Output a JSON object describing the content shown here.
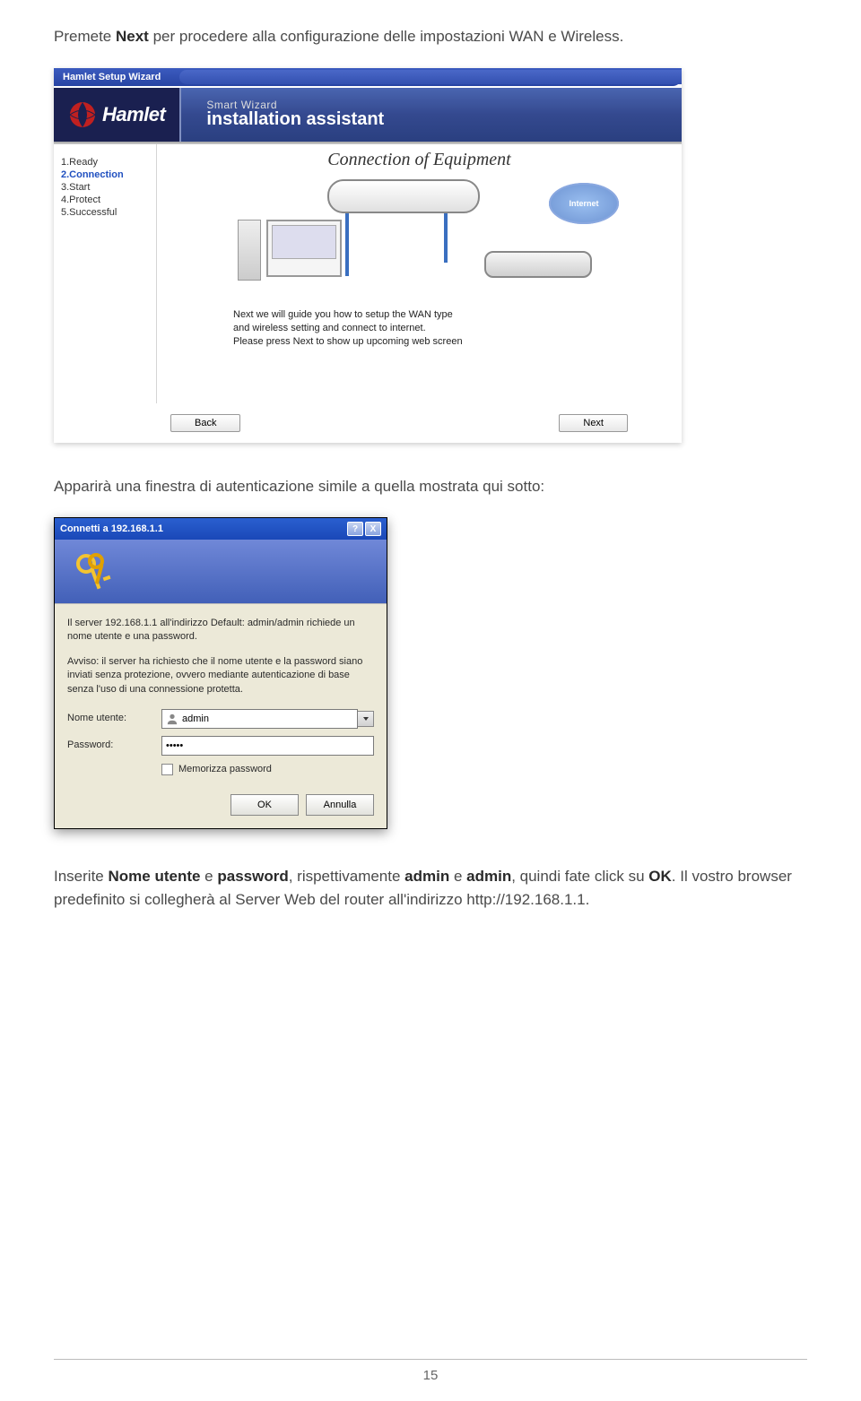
{
  "intro": {
    "pre": "Premete ",
    "bold": "Next",
    "post": " per procedere alla configurazione delle impostazioni WAN e Wireless."
  },
  "wizard": {
    "window_title": "Hamlet Setup Wizard",
    "logo_text": "Hamlet",
    "header_small": "Smart Wizard",
    "header_big": "installation assistant",
    "main_title": "Connection of Equipment",
    "sidebar": [
      {
        "label": "1.Ready"
      },
      {
        "label": "2.Connection",
        "active": true
      },
      {
        "label": "3.Start"
      },
      {
        "label": "4.Protect"
      },
      {
        "label": "5.Successful"
      }
    ],
    "cloud_label": "Internet",
    "instruction_l1": "Next we will guide you how to setup the WAN type",
    "instruction_l2": "and wireless setting and connect to internet.",
    "instruction_l3": "Please press Next to show up upcoming web screen",
    "back_btn": "Back",
    "next_btn": "Next"
  },
  "mid_para": "Apparirà una finestra di autenticazione simile a quella mostrata qui sotto:",
  "auth": {
    "title": "Connetti a 192.168.1.1",
    "help_btn": "?",
    "close_btn": "X",
    "line1": "Il server 192.168.1.1 all'indirizzo Default: admin/admin richiede un nome utente e una password.",
    "warn": "Avviso: il server ha richiesto che il nome utente e la password siano inviati senza protezione, ovvero mediante autenticazione di base senza l'uso di una connessione protetta.",
    "user_label": "Nome utente:",
    "user_value": "admin",
    "pass_label": "Password:",
    "pass_value": "•••••",
    "remember_label": "Memorizza password",
    "ok_btn": "OK",
    "cancel_btn": "Annulla"
  },
  "outro": {
    "pre": "Inserite ",
    "b1": "Nome utente",
    "mid1": " e ",
    "b2": "password",
    "mid2": ", rispettivamente ",
    "b3": "admin",
    "mid3": " e ",
    "b4": "admin",
    "mid4": ", quindi fate click su ",
    "b5": "OK",
    "post": ". Il vostro browser predefinito si collegherà al Server Web del router all'indirizzo http://192.168.1.1."
  },
  "page_number": "15"
}
